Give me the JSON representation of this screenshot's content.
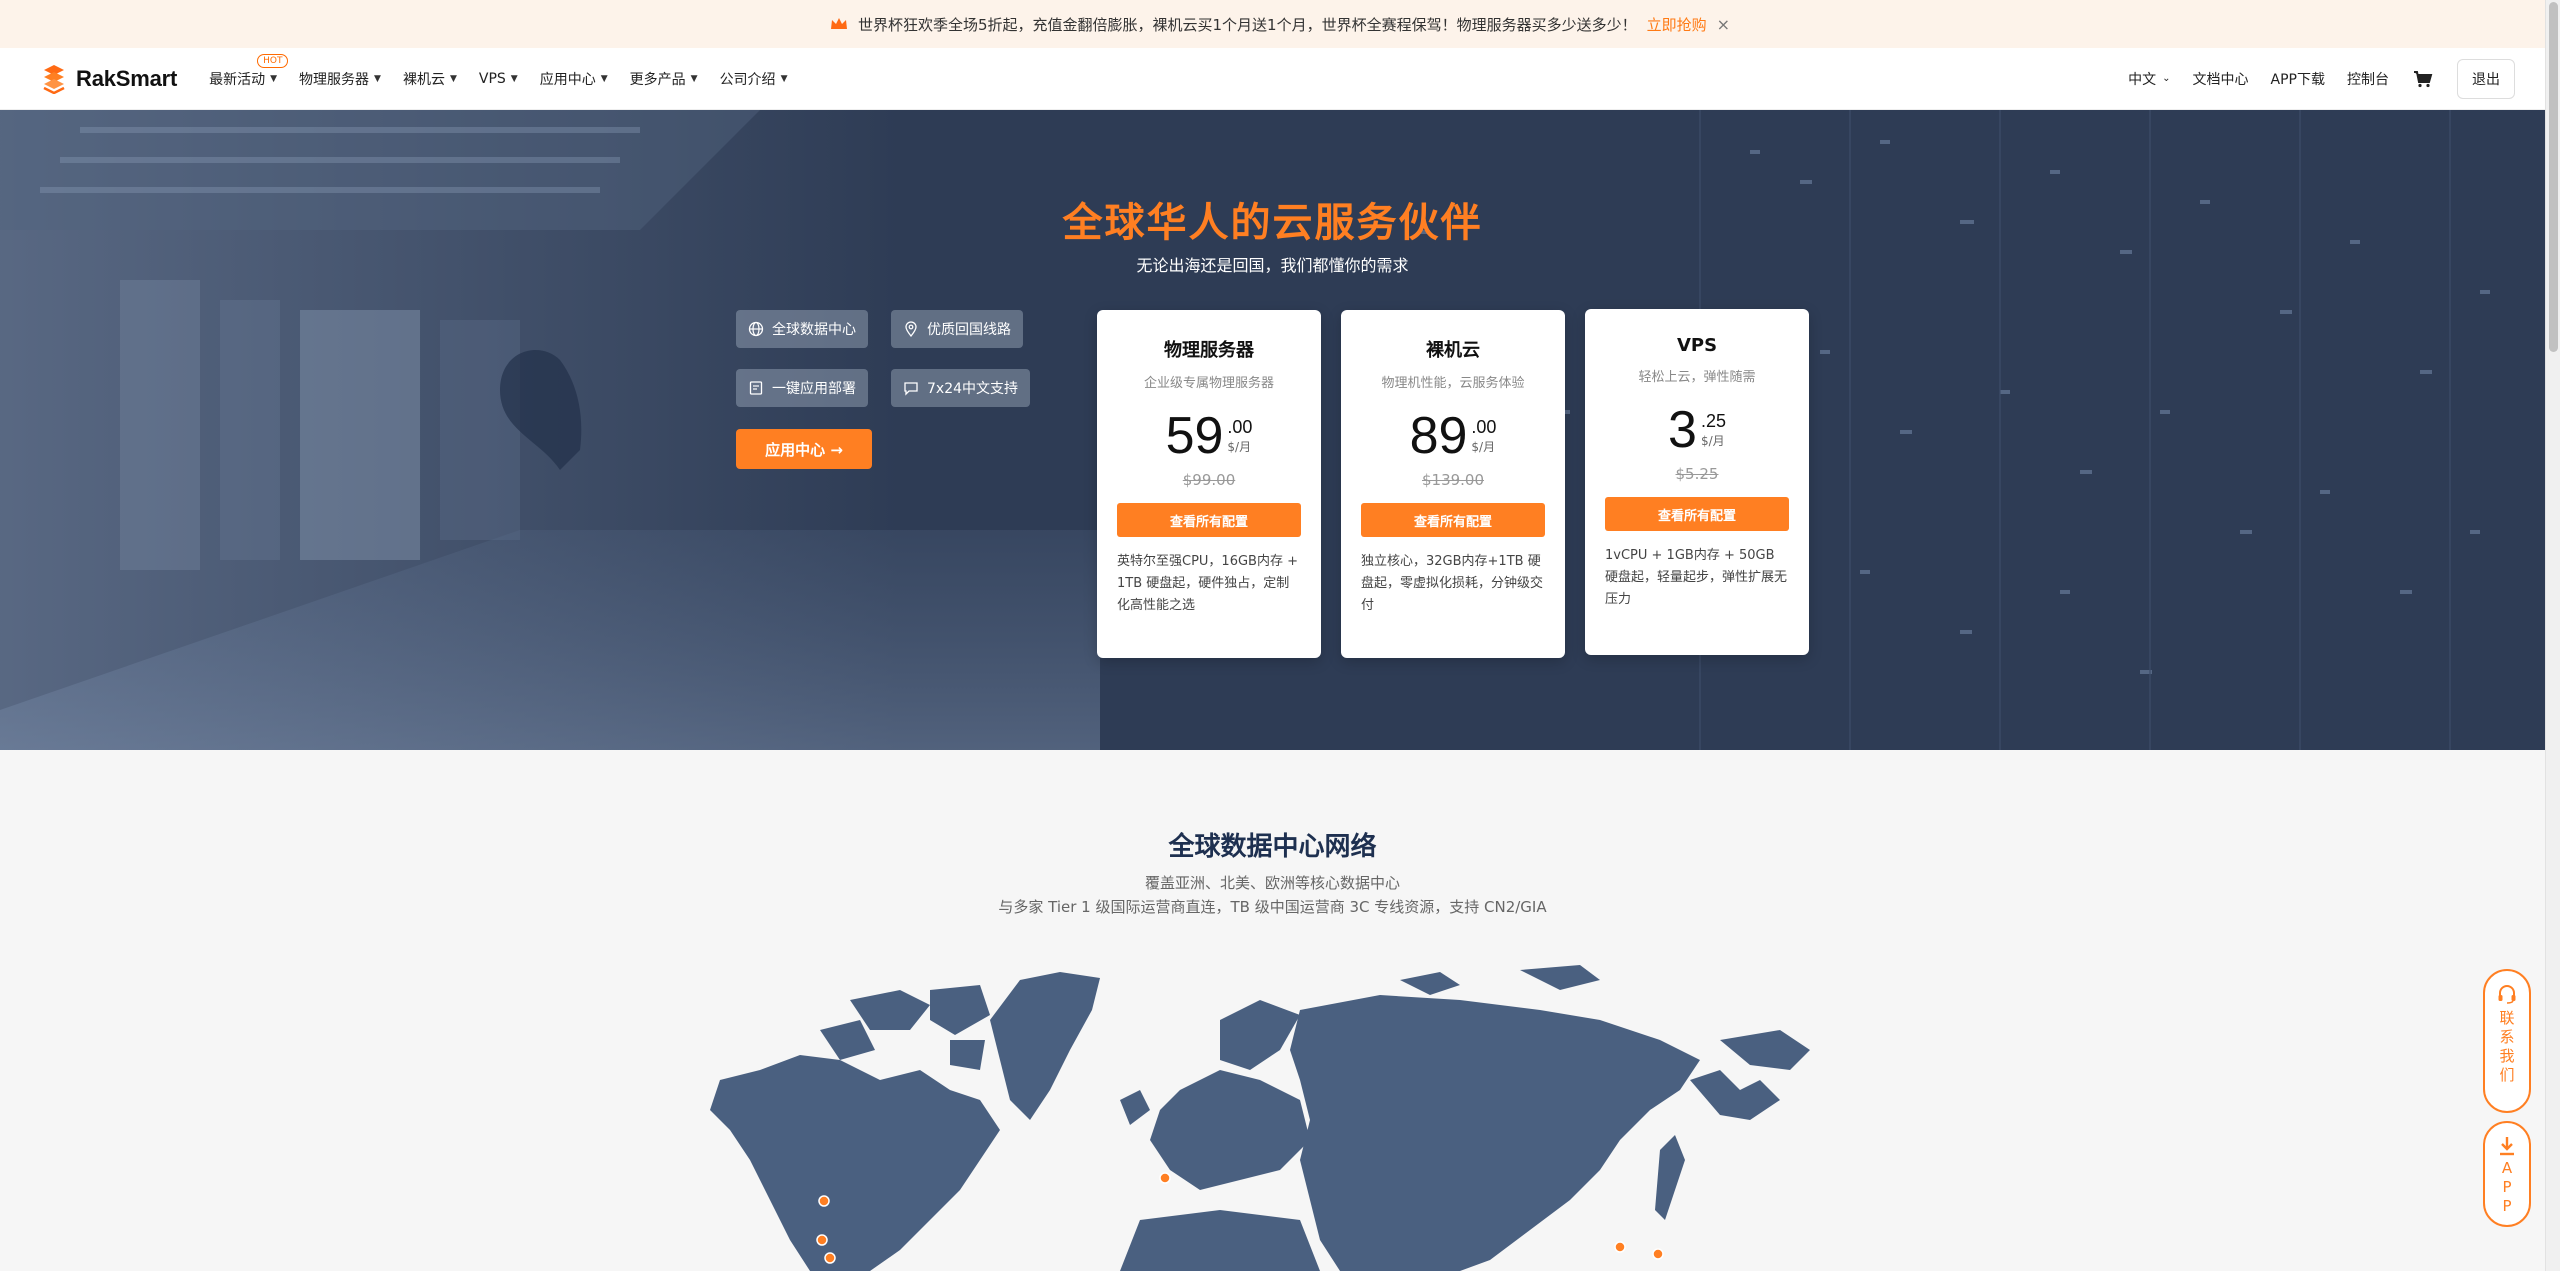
{
  "promo": {
    "text": "世界杯狂欢季全场5折起，充值金翻倍膨胀，裸机云买1个月送1个月，世界杯全赛程保驾！物理服务器买多少送多少！",
    "cta": "立即抢购",
    "close": "×"
  },
  "nav": {
    "brand": "RakSmart",
    "hot_badge": "HOT",
    "items": [
      "最新活动",
      "物理服务器",
      "裸机云",
      "VPS",
      "应用中心",
      "更多产品",
      "公司介绍"
    ],
    "lang": "中文",
    "docs": "文档中心",
    "app": "APP下载",
    "console": "控制台",
    "logout": "退出"
  },
  "hero": {
    "title": "全球华人的云服务伙伴",
    "subtitle": "无论出海还是回国，我们都懂你的需求",
    "features": [
      "全球数据中心",
      "优质回国线路",
      "一键应用部署",
      "7x24中文支持"
    ],
    "app_button": "应用中心 →",
    "cards": [
      {
        "title": "物理服务器",
        "subtitle": "企业级专属物理服务器",
        "price_int": "59",
        "price_dec": ".00",
        "unit": "$/月",
        "original": "$99.00",
        "button": "查看所有配置",
        "desc": "英特尔至强CPU，16GB内存 + 1TB 硬盘起，硬件独占，定制化高性能之选"
      },
      {
        "title": "裸机云",
        "subtitle": "物理机性能，云服务体验",
        "price_int": "89",
        "price_dec": ".00",
        "unit": "$/月",
        "original": "$139.00",
        "button": "查看所有配置",
        "desc": "独立核心，32GB内存+1TB 硬盘起，零虚拟化损耗，分钟级交付"
      },
      {
        "title": "VPS",
        "subtitle": "轻松上云，弹性随需",
        "price_int": "3",
        "price_dec": ".25",
        "unit": "$/月",
        "original": "$5.25",
        "button": "查看所有配置",
        "desc": "1vCPU + 1GB内存 + 50GB 硬盘起，轻量起步，弹性扩展无压力"
      }
    ]
  },
  "network": {
    "title": "全球数据中心网络",
    "line1": "覆盖亚洲、北美、欧洲等核心数据中心",
    "line2": "与多家 Tier 1 级国际运营商直连，TB 级中国运营商 3C 专线资源，支持 CN2/GIA"
  },
  "float": {
    "contact": [
      "联",
      "系",
      "我",
      "们"
    ],
    "app": [
      "A",
      "P",
      "P"
    ]
  },
  "colors": {
    "accent": "#ff7f22",
    "hero_bg": "#2f3e56",
    "map": "#4a6080"
  }
}
